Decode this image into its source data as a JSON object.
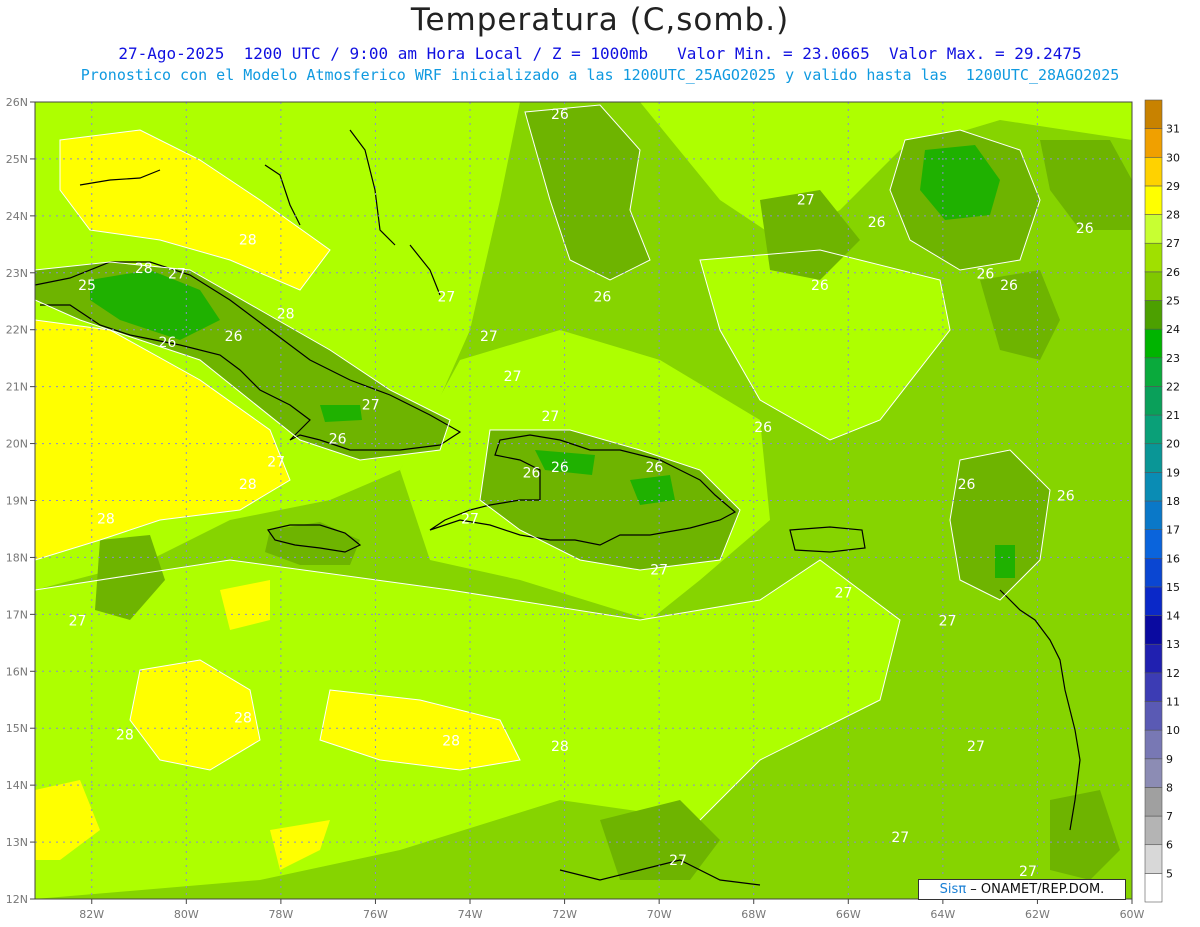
{
  "header": {
    "title": "Temperatura (C,somb.)",
    "subtitle_line1": "27-Ago-2025  1200 UTC / 9:00 am Hora Local / Z = 1000mb   Valor Min. = 23.0665  Valor Max. = 29.2475",
    "subtitle_line2": "Pronostico con el Modelo Atmosferico WRF inicializado a las 1200UTC_25AGO2025 y valido hasta las  1200UTC_28AGO2025"
  },
  "map": {
    "lon_range": [
      -83.2,
      -60
    ],
    "lat_range": [
      12,
      26
    ],
    "lon_ticks": [
      "82W",
      "80W",
      "78W",
      "76W",
      "74W",
      "72W",
      "70W",
      "68W",
      "66W",
      "64W",
      "62W",
      "60W"
    ],
    "lat_ticks": [
      "12N",
      "13N",
      "14N",
      "15N",
      "16N",
      "17N",
      "18N",
      "19N",
      "20N",
      "21N",
      "22N",
      "23N",
      "24N",
      "25N",
      "26N"
    ],
    "contour_labels": [
      {
        "text": "26",
        "lon": -72.1,
        "lat": 25.7
      },
      {
        "text": "27",
        "lon": -66.9,
        "lat": 24.2
      },
      {
        "text": "26",
        "lon": -65.4,
        "lat": 23.8
      },
      {
        "text": "26",
        "lon": -61.0,
        "lat": 23.7
      },
      {
        "text": "28",
        "lon": -78.7,
        "lat": 23.5
      },
      {
        "text": "28",
        "lon": -80.9,
        "lat": 23.0
      },
      {
        "text": "27",
        "lon": -80.2,
        "lat": 22.9
      },
      {
        "text": "26",
        "lon": -63.1,
        "lat": 22.9
      },
      {
        "text": "26",
        "lon": -62.6,
        "lat": 22.7
      },
      {
        "text": "26",
        "lon": -66.6,
        "lat": 22.7
      },
      {
        "text": "25",
        "lon": -82.1,
        "lat": 22.7
      },
      {
        "text": "27",
        "lon": -74.5,
        "lat": 22.5
      },
      {
        "text": "26",
        "lon": -71.2,
        "lat": 22.5
      },
      {
        "text": "28",
        "lon": -77.9,
        "lat": 22.2
      },
      {
        "text": "27",
        "lon": -73.6,
        "lat": 21.8
      },
      {
        "text": "26",
        "lon": -79.0,
        "lat": 21.8
      },
      {
        "text": "26",
        "lon": -80.4,
        "lat": 21.7
      },
      {
        "text": "27",
        "lon": -73.1,
        "lat": 21.1
      },
      {
        "text": "27",
        "lon": -76.1,
        "lat": 20.6
      },
      {
        "text": "27",
        "lon": -72.3,
        "lat": 20.4
      },
      {
        "text": "26",
        "lon": -67.8,
        "lat": 20.2
      },
      {
        "text": "26",
        "lon": -76.8,
        "lat": 20.0
      },
      {
        "text": "27",
        "lon": -78.1,
        "lat": 19.6
      },
      {
        "text": "26",
        "lon": -72.1,
        "lat": 19.5
      },
      {
        "text": "26",
        "lon": -72.7,
        "lat": 19.4
      },
      {
        "text": "26",
        "lon": -70.1,
        "lat": 19.5
      },
      {
        "text": "28",
        "lon": -78.7,
        "lat": 19.2
      },
      {
        "text": "26",
        "lon": -63.5,
        "lat": 19.2
      },
      {
        "text": "26",
        "lon": -61.4,
        "lat": 19.0
      },
      {
        "text": "28",
        "lon": -81.7,
        "lat": 18.6
      },
      {
        "text": "27",
        "lon": -74.0,
        "lat": 18.6
      },
      {
        "text": "27",
        "lon": -70.0,
        "lat": 17.7
      },
      {
        "text": "27",
        "lon": -66.1,
        "lat": 17.3
      },
      {
        "text": "27",
        "lon": -82.3,
        "lat": 16.8
      },
      {
        "text": "27",
        "lon": -63.9,
        "lat": 16.8
      },
      {
        "text": "28",
        "lon": -78.8,
        "lat": 15.1
      },
      {
        "text": "28",
        "lon": -81.3,
        "lat": 14.8
      },
      {
        "text": "28",
        "lon": -74.4,
        "lat": 14.7
      },
      {
        "text": "28",
        "lon": -72.1,
        "lat": 14.6
      },
      {
        "text": "27",
        "lon": -63.3,
        "lat": 14.6
      },
      {
        "text": "27",
        "lon": -64.9,
        "lat": 13.0
      },
      {
        "text": "27",
        "lon": -69.6,
        "lat": 12.6
      },
      {
        "text": "27",
        "lon": -62.2,
        "lat": 12.4
      }
    ]
  },
  "colorbar": {
    "labels": [
      "5",
      "6",
      "7",
      "8",
      "9",
      "10",
      "11",
      "12",
      "13",
      "14",
      "15",
      "16",
      "17",
      "18",
      "19",
      "20",
      "21",
      "22",
      "23",
      "24",
      "25",
      "26",
      "27",
      "28",
      "29",
      "30",
      "31"
    ],
    "colors": [
      "#ffffff",
      "#d8d8d8",
      "#b4b4b4",
      "#a0a0a0",
      "#8c8cb4",
      "#7878b4",
      "#5a5ab4",
      "#3c3cb4",
      "#2020b0",
      "#0a0aa0",
      "#0a28c8",
      "#0a46d2",
      "#0a64dc",
      "#0a78c8",
      "#0a8cb4",
      "#0a9696",
      "#0aa078",
      "#0aa05a",
      "#0aaa3c",
      "#00b400",
      "#4ca000",
      "#80c800",
      "#a0e000",
      "#c8ff32",
      "#ffff00",
      "#ffd200",
      "#f0a000",
      "#c88200"
    ]
  },
  "credit": {
    "sis": "Sis",
    "pi": "π",
    "org": "ONAMET/REP.DOM."
  }
}
